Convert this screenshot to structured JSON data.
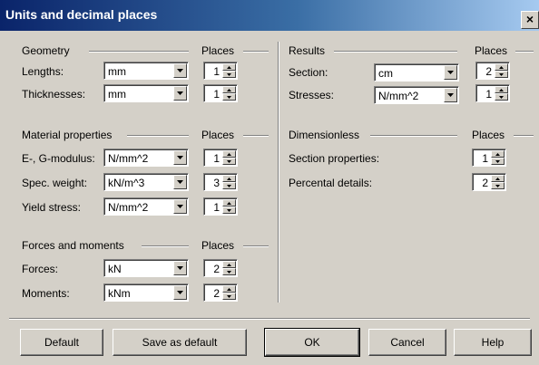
{
  "dialog": {
    "title": "Units and decimal places",
    "close_label": "×"
  },
  "geometry": {
    "header": "Geometry",
    "places_header": "Places",
    "rows": [
      {
        "label": "Lengths:",
        "unit": "mm",
        "places": "1"
      },
      {
        "label": "Thicknesses:",
        "unit": "mm",
        "places": "1"
      }
    ]
  },
  "material": {
    "header": "Material properties",
    "places_header": "Places",
    "rows": [
      {
        "label": "E-, G-modulus:",
        "unit": "N/mm^2",
        "places": "1"
      },
      {
        "label": "Spec. weight:",
        "unit": "kN/m^3",
        "places": "3"
      },
      {
        "label": "Yield stress:",
        "unit": "N/mm^2",
        "places": "1"
      }
    ]
  },
  "forces": {
    "header": "Forces and moments",
    "places_header": "Places",
    "rows": [
      {
        "label": "Forces:",
        "unit": "kN",
        "places": "2"
      },
      {
        "label": "Moments:",
        "unit": "kNm",
        "places": "2"
      }
    ]
  },
  "results": {
    "header": "Results",
    "places_header": "Places",
    "rows": [
      {
        "label": "Section:",
        "unit": "cm",
        "places": "2"
      },
      {
        "label": "Stresses:",
        "unit": "N/mm^2",
        "places": "1"
      }
    ]
  },
  "dimensionless": {
    "header": "Dimensionless",
    "places_header": "Places",
    "rows": [
      {
        "label": "Section properties:",
        "places": "1"
      },
      {
        "label": "Percental details:",
        "places": "2"
      }
    ]
  },
  "buttons": {
    "default": "Default",
    "save_default": "Save as default",
    "ok": "OK",
    "cancel": "Cancel",
    "help": "Help"
  }
}
